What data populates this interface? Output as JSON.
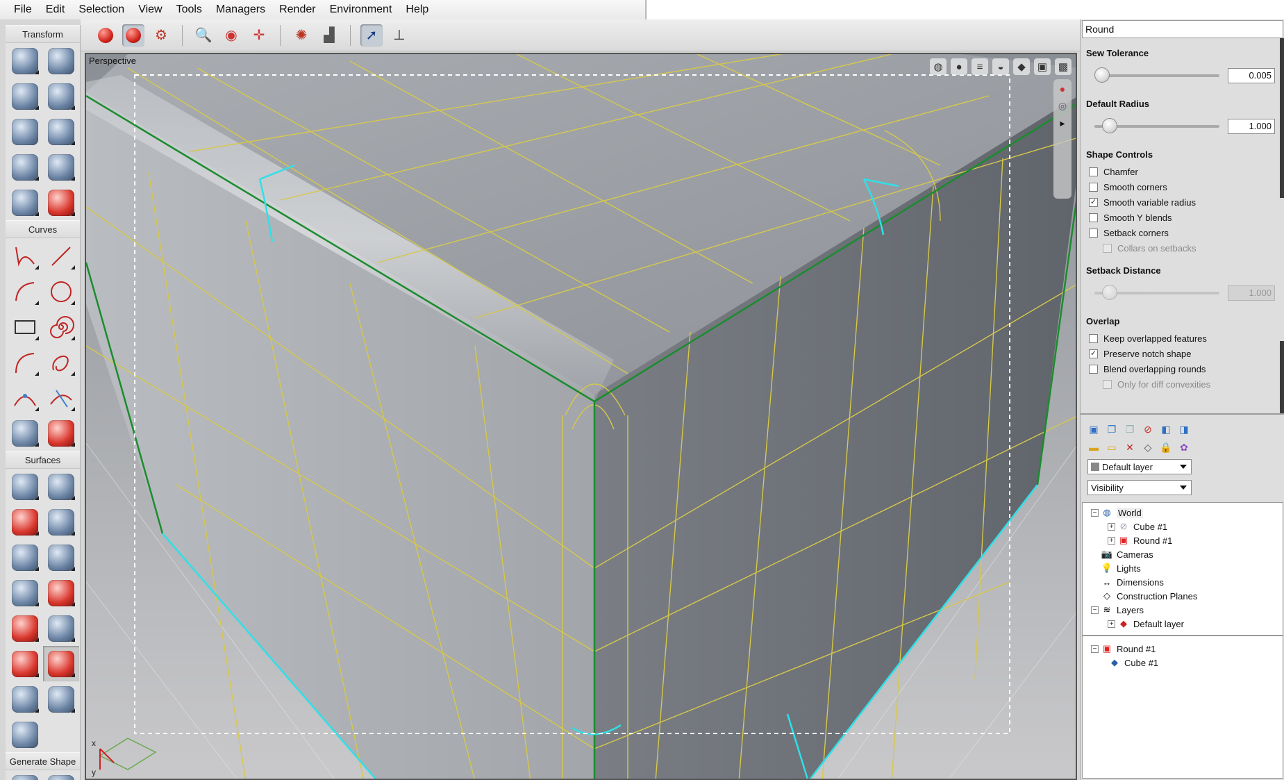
{
  "menu": [
    "File",
    "Edit",
    "Selection",
    "View",
    "Tools",
    "Managers",
    "Render",
    "Environment",
    "Help"
  ],
  "toolbox": {
    "sections": {
      "transform": "Transform",
      "curves": "Curves",
      "surfaces": "Surfaces",
      "generate": "Generate Shape"
    }
  },
  "viewport": {
    "label": "Perspective",
    "axis_x": "x",
    "axis_y": "y"
  },
  "panel": {
    "title": "Round",
    "sew_tolerance": {
      "label": "Sew Tolerance",
      "value": "0.005",
      "level": 0
    },
    "default_radius": {
      "label": "Default Radius",
      "value": "1.000",
      "level": 0.07
    },
    "shape_controls": {
      "label": "Shape Controls",
      "options": [
        {
          "label": "Chamfer",
          "checked": false
        },
        {
          "label": "Smooth corners",
          "checked": false
        },
        {
          "label": "Smooth variable radius",
          "checked": true
        },
        {
          "label": "Smooth Y blends",
          "checked": false
        },
        {
          "label": "Setback corners",
          "checked": false
        },
        {
          "label": "Collars on setbacks",
          "checked": false,
          "disabled": true
        }
      ]
    },
    "setback_distance": {
      "label": "Setback Distance",
      "value": "1.000",
      "level": 0.07
    },
    "overlap": {
      "label": "Overlap",
      "options": [
        {
          "label": "Keep overlapped features",
          "checked": false
        },
        {
          "label": "Preserve notch shape",
          "checked": true
        },
        {
          "label": "Blend overlapping rounds",
          "checked": false
        },
        {
          "label": "Only for diff convexities",
          "checked": false,
          "disabled": true
        }
      ]
    },
    "check_mark": "✓",
    "layer_select": "Default layer",
    "visibility_select": "Visibility",
    "tree": {
      "world": "World",
      "cube1": "Cube #1",
      "round1": "Round #1",
      "cameras": "Cameras",
      "lights": "Lights",
      "dimensions": "Dimensions",
      "construction_planes": "Construction Planes",
      "layers": "Layers",
      "default_layer": "Default layer"
    },
    "history": {
      "round1": "Round #1",
      "cube1": "Cube #1"
    }
  },
  "colors": {
    "edge_green": "#1a8c2e",
    "wire_yellow": "#d6c84a",
    "edge_cyan": "#2fe0e8"
  }
}
